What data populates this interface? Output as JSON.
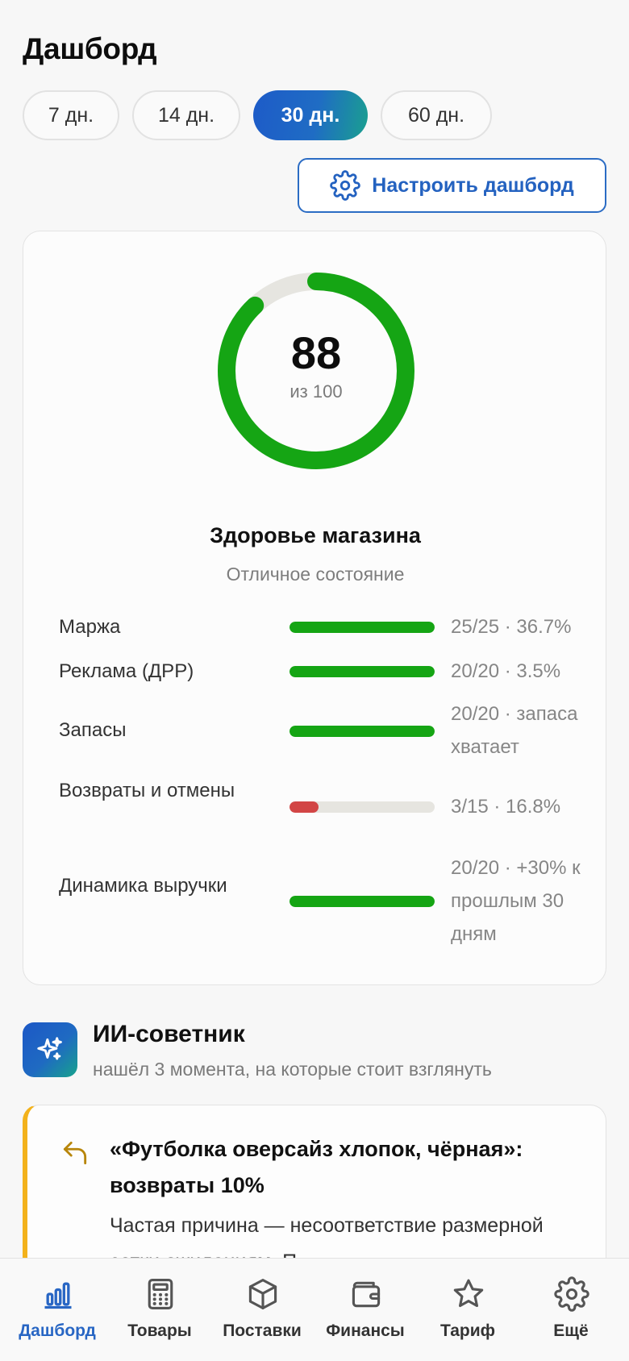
{
  "header": {
    "title": "Дашборд"
  },
  "periods": [
    {
      "label": "7 дн.",
      "active": false
    },
    {
      "label": "14 дн.",
      "active": false
    },
    {
      "label": "30 дн.",
      "active": true
    },
    {
      "label": "60 дн.",
      "active": false
    }
  ],
  "config_button": {
    "label": "Настроить дашборд",
    "icon": "gear-icon"
  },
  "health": {
    "score": "88",
    "score_of": "из 100",
    "score_fraction": 0.88,
    "title": "Здоровье магазина",
    "state": "Отличное состояние",
    "colors": {
      "good": "#15a514",
      "bad": "#d24545",
      "track": "#e6e5e0"
    },
    "metrics": [
      {
        "label": "Маржа",
        "value": "25/25 · 36.7%",
        "fill": 1.0,
        "status": "good"
      },
      {
        "label": "Реклама (ДРР)",
        "value": "20/20 · 3.5%",
        "fill": 1.0,
        "status": "good"
      },
      {
        "label": "Запасы",
        "value": "20/20 · запаса хватает",
        "fill": 1.0,
        "status": "good"
      },
      {
        "label": "Возвраты и отмены",
        "value": "3/15 · 16.8%",
        "fill": 0.2,
        "status": "bad"
      },
      {
        "label": "Динамика выручки",
        "value": "20/20 · +30% к прошлым 30 дням",
        "fill": 1.0,
        "status": "good"
      }
    ]
  },
  "ai": {
    "icon": "sparkles-icon",
    "title": "ИИ-советник",
    "subtitle": "нашёл 3 момента, на которые стоит взглянуть",
    "advice": {
      "icon": "return-arrow-icon",
      "title": "«Футболка оверсайз хлопок, чёрная»: возвраты 10%",
      "body": "Частая причина — несоответствие размерной сетки ожиданиям. П"
    }
  },
  "tabbar": [
    {
      "label": "Дашборд",
      "icon": "bar-chart-icon",
      "active": true
    },
    {
      "label": "Товары",
      "icon": "calculator-icon",
      "active": false
    },
    {
      "label": "Поставки",
      "icon": "box-icon",
      "active": false
    },
    {
      "label": "Финансы",
      "icon": "wallet-icon",
      "active": false
    },
    {
      "label": "Тариф",
      "icon": "star-icon",
      "active": false
    },
    {
      "label": "Ещё",
      "icon": "gear-icon",
      "active": false
    }
  ]
}
